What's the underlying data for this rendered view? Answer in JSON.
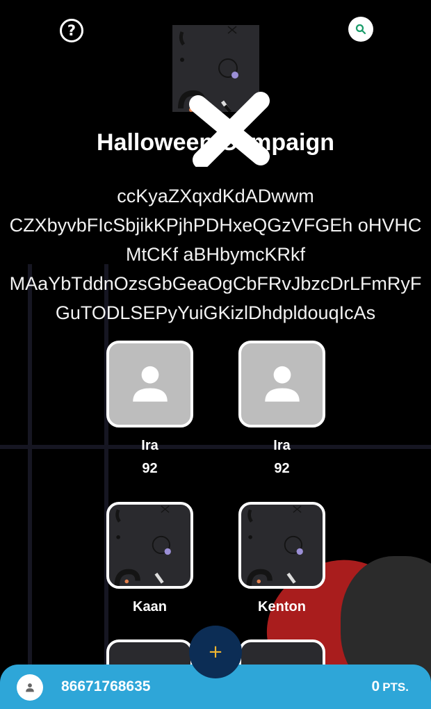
{
  "header": {
    "help_icon": "help-circle-icon",
    "search_icon": "search-icon"
  },
  "campaign": {
    "title": "Halloween Campaign",
    "description_lines": [
      "ccKyaZXqxdKdADwwm",
      "CZXbyvbFIcSbjikKPjhPDHxeQGzVFGEh oHVHC",
      "MtCKf aBHbymcKRkf",
      "MAaYbTddnOzsGbGeaOgCbFRvJbzcDrLFmRyF",
      "GuTODLSEPyYuiGKizlDhdpldouqIcAs"
    ]
  },
  "participants": [
    {
      "name": "Ira",
      "score": "92",
      "image": "placeholder-user"
    },
    {
      "name": "Ira",
      "score": "92",
      "image": "placeholder-user"
    },
    {
      "name": "Kaan",
      "score": "",
      "image": "pattern"
    },
    {
      "name": "Kenton",
      "score": "",
      "image": "pattern"
    }
  ],
  "fab": {
    "label": "+"
  },
  "bottom_bar": {
    "user_id": "86671768635",
    "points_value": "0",
    "points_unit": "PTS."
  },
  "colors": {
    "background": "#000000",
    "bottom_bar": "#2ea6d8",
    "fab": "#0c2d55",
    "fab_plus": "#f2b630",
    "search_icon": "#1a9c6a"
  }
}
